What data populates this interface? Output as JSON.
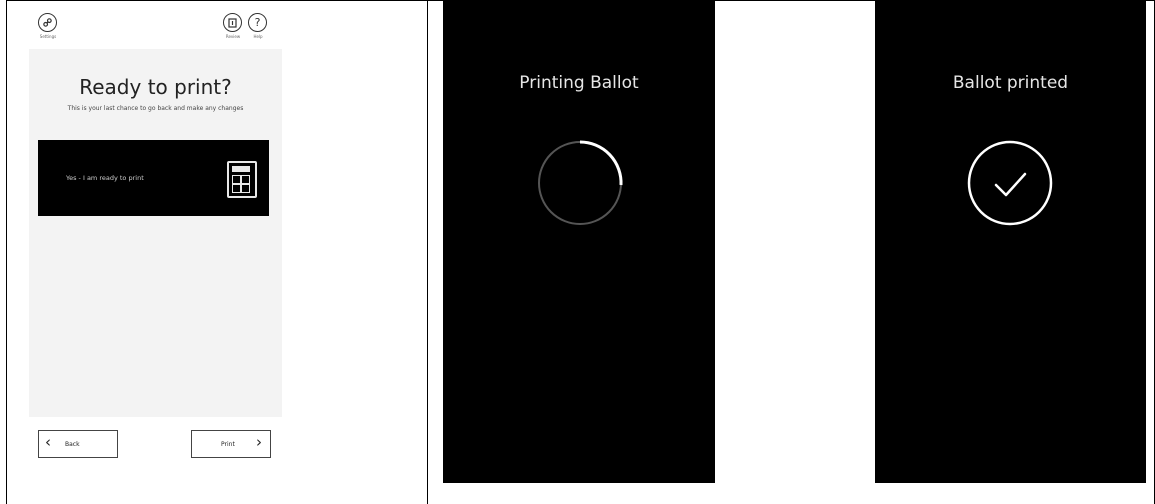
{
  "screen1": {
    "top_left_icon": "settings-icon",
    "top_left_caption": "Settings",
    "top_right_icons": [
      {
        "icon": "ballot-save-icon",
        "caption": "Review"
      },
      {
        "icon": "help-icon",
        "caption": "Help",
        "glyph": "?"
      }
    ],
    "title": "Ready to print?",
    "subtitle": "This is your last chance to go back and make any changes",
    "ready_button_label": "Yes - I am ready to print",
    "ready_button_icon": "ballot-sheet-icon",
    "back_label": "Back",
    "print_label": "Print"
  },
  "screen2": {
    "heading": "Printing Ballot",
    "status_icon": "loading-spinner-icon"
  },
  "screen3": {
    "heading": "Ballot printed",
    "status_icon": "checkmark-icon"
  }
}
